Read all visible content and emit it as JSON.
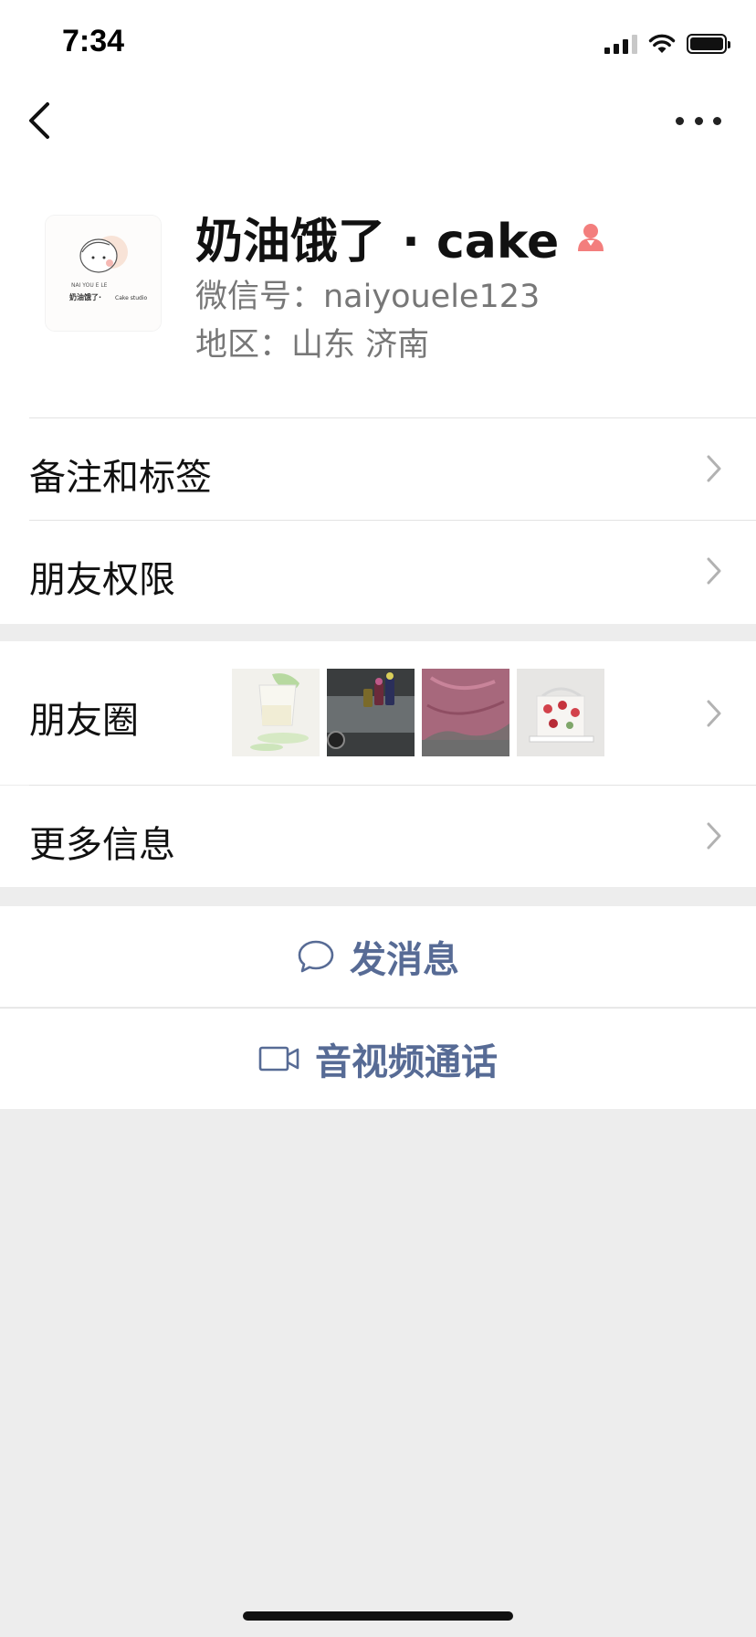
{
  "status_bar": {
    "time": "7:34"
  },
  "profile": {
    "name": "奶油饿了 · cake",
    "wechat_id": "微信号：naiyouele123",
    "region": "地区：山东 济南",
    "avatar_text_small": "NAI YOU E LE",
    "avatar_text_main": "奶油饿了·",
    "avatar_text_sub": "Cake studio"
  },
  "menu": {
    "remark_tags": "备注和标签",
    "friend_permissions": "朋友权限",
    "moments": "朋友圈",
    "more_info": "更多信息"
  },
  "actions": {
    "send_message": "发消息",
    "video_call": "音视频通话"
  },
  "colors": {
    "link_blue": "#576b95",
    "gender_female": "#f37e7d",
    "background": "#ededed"
  }
}
